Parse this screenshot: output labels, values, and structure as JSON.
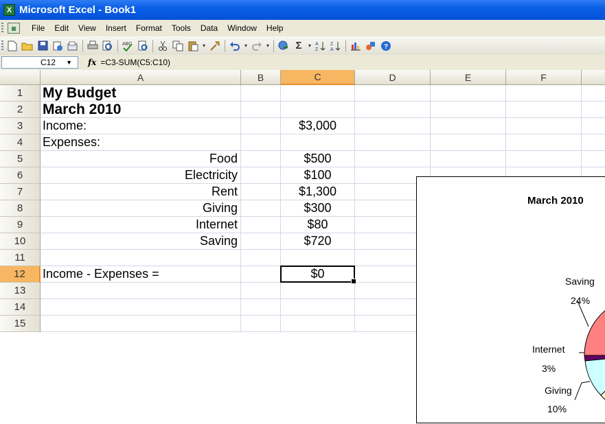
{
  "window": {
    "title": "Microsoft Excel - Book1",
    "app_icon": "excel-icon"
  },
  "menu": [
    "File",
    "Edit",
    "View",
    "Insert",
    "Format",
    "Tools",
    "Data",
    "Window",
    "Help"
  ],
  "formula_bar": {
    "name_box": "C12",
    "fx": "fx",
    "formula": "=C3-SUM(C5:C10)"
  },
  "columns": [
    "A",
    "B",
    "C",
    "D",
    "E",
    "F"
  ],
  "active_col": "C",
  "active_row": 12,
  "rows": [
    {
      "n": "1",
      "a": "My Budget",
      "c": ""
    },
    {
      "n": "2",
      "a": "March 2010",
      "c": ""
    },
    {
      "n": "3",
      "a": "Income:",
      "c": "$3,000"
    },
    {
      "n": "4",
      "a": "Expenses:",
      "c": ""
    },
    {
      "n": "5",
      "a": "Food",
      "c": "$500"
    },
    {
      "n": "6",
      "a": "Electricity",
      "c": "$100"
    },
    {
      "n": "7",
      "a": "Rent",
      "c": "$1,300"
    },
    {
      "n": "8",
      "a": "Giving",
      "c": "$300"
    },
    {
      "n": "9",
      "a": "Internet",
      "c": "$80"
    },
    {
      "n": "10",
      "a": "Saving",
      "c": "$720"
    },
    {
      "n": "11",
      "a": "",
      "c": ""
    },
    {
      "n": "12",
      "a": "Income - Expenses =",
      "c": "$0"
    },
    {
      "n": "13",
      "a": "",
      "c": ""
    },
    {
      "n": "14",
      "a": "",
      "c": ""
    },
    {
      "n": "15",
      "a": "",
      "c": ""
    }
  ],
  "chart": {
    "title": "March 2010",
    "labels": [
      {
        "name": "Saving",
        "pct": "24%"
      },
      {
        "name": "Internet",
        "pct": "3%"
      },
      {
        "name": "Giving",
        "pct": "10%"
      }
    ],
    "colors": {
      "saving": "#ff8080",
      "internet": "#660066",
      "giving": "#ccffff",
      "other": "#ffffcc"
    }
  }
}
